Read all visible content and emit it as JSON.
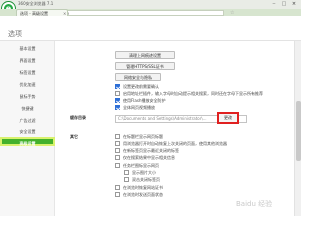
{
  "app": {
    "title": "360安全浏览器 7.1"
  },
  "tab": {
    "label": "选项 - 高级设置"
  },
  "address": {
    "url": "se:settings/advance"
  },
  "page": {
    "title": "选项"
  },
  "sidebar": {
    "items": [
      {
        "label": "基本设置"
      },
      {
        "label": "界面设置"
      },
      {
        "label": "标签设置"
      },
      {
        "label": "优化加速"
      },
      {
        "label": "鼠标手势"
      },
      {
        "label": "快捷键"
      },
      {
        "label": "广告过滤"
      },
      {
        "label": "安全设置"
      },
      {
        "label": "高级设置"
      }
    ]
  },
  "buttons": {
    "proxy": "清理上网痕迹设置",
    "certs": "管理HTTPS/SSL证书",
    "content": "网络安全与隐私"
  },
  "top_options": [
    {
      "label": "设置更改前需要确认",
      "checked": true
    },
    {
      "label": "启用地址栏插件，输入字母时自动提示相关搜索，同时还在字母下显示所有推荐",
      "checked": false
    },
    {
      "label": "使用Flash播放安全防护",
      "checked": true
    },
    {
      "label": "全体网页视频播放",
      "checked": true
    }
  ],
  "cache": {
    "label": "缓存目录",
    "path": "C:\\Documents and Settings\\Administrator\\...",
    "change_label": "更改"
  },
  "other": {
    "label": "其它",
    "options": [
      {
        "label": "在标题栏显示网页标题",
        "checked": false
      },
      {
        "label": "用浏览器打开时自动恢复上次关闭的页面，使用其他浏览器",
        "checked": false
      },
      {
        "label": "在新标签页显示最近关闭的标签",
        "checked": false
      },
      {
        "label": "仅在搜索结果中显示相关信息",
        "checked": false
      },
      {
        "label": "任务栏图标显示网页",
        "checked": false
      },
      {
        "label": "显示图片大小",
        "checked": false
      },
      {
        "label": "双击关闭标签页",
        "checked": false
      },
      {
        "label": "在浏览时恢复网站证书",
        "checked": false
      },
      {
        "label": "在浏览时发送页面状态",
        "checked": false
      }
    ]
  },
  "watermark": "Baidu 经验",
  "colors": {
    "accent": "#43b12c",
    "highlight": "#e02020"
  }
}
